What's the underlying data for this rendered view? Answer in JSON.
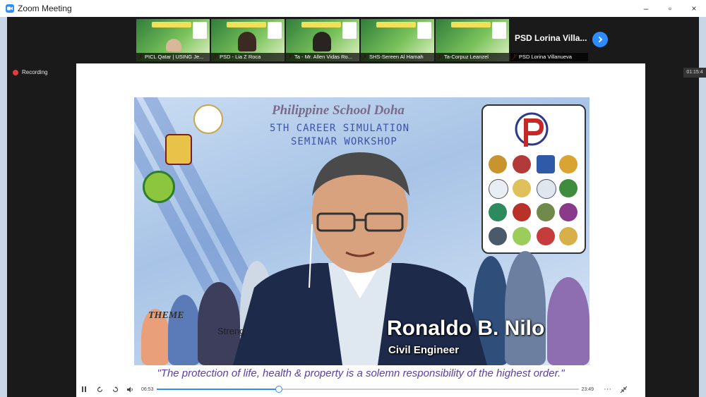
{
  "window": {
    "title": "Zoom Meeting",
    "controls": [
      "–",
      "▫",
      "×"
    ]
  },
  "participants": [
    {
      "caption": "PICL Qatar | USING Je..."
    },
    {
      "caption": "PSD - Lia Z Roca"
    },
    {
      "caption": "Ta - Mr. Allen Vidas Ro..."
    },
    {
      "caption": "SHS-Sereen Al Hamah"
    },
    {
      "caption": "Ta-Corpuz Leanzel"
    },
    {
      "big_name": "PSD Lorina Villa...",
      "caption": "PSD Lorina Villanueva"
    }
  ],
  "recording": {
    "label": "Recording"
  },
  "clock": "01:15:4",
  "slide": {
    "school": "Philippine School Doha",
    "subtitle_line1": "5TH CAREER SIMULATION",
    "subtitle_line2": "SEMINAR WORKSHOP",
    "theme_label": "THEME",
    "theme_partial": "Streng",
    "speaker_name": "Ronaldo B. Nilo",
    "speaker_role": "Civil Engineer",
    "quote": "\"The protection of life, health & property is a solemn responsibility of the highest order.\""
  },
  "player": {
    "elapsed": "06:53",
    "duration": "23:49",
    "progress_fraction": 0.29,
    "more": "···"
  },
  "colors": {
    "zoom_blue": "#2d8cff",
    "quote_purple": "#5b3fa8",
    "recording_red": "#e23b3b"
  },
  "icons": [
    "zoom-app-icon",
    "chevron-right-icon",
    "recording-dot-icon",
    "pause-icon",
    "replay-icon",
    "forward-icon",
    "volume-icon",
    "collapse-icon",
    "microphone-muted-icon"
  ]
}
